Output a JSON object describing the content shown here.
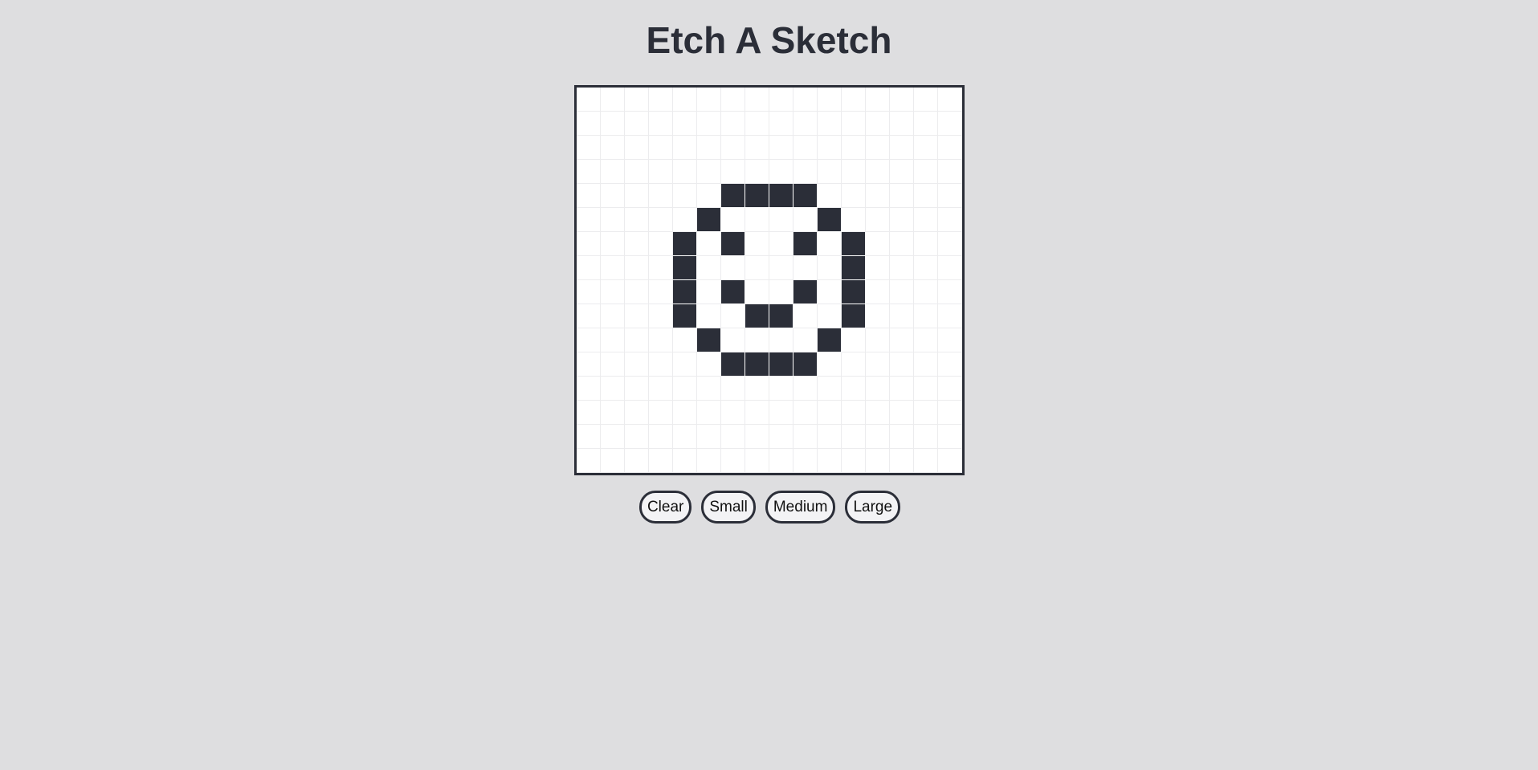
{
  "title": "Etch A Sketch",
  "grid": {
    "size": 16,
    "filled_cells": [
      [
        4,
        6
      ],
      [
        4,
        7
      ],
      [
        4,
        8
      ],
      [
        4,
        9
      ],
      [
        5,
        5
      ],
      [
        5,
        10
      ],
      [
        6,
        4
      ],
      [
        6,
        6
      ],
      [
        6,
        9
      ],
      [
        6,
        11
      ],
      [
        7,
        4
      ],
      [
        7,
        11
      ],
      [
        8,
        4
      ],
      [
        8,
        6
      ],
      [
        8,
        9
      ],
      [
        8,
        11
      ],
      [
        9,
        4
      ],
      [
        9,
        7
      ],
      [
        9,
        8
      ],
      [
        9,
        11
      ],
      [
        10,
        5
      ],
      [
        10,
        10
      ],
      [
        11,
        6
      ],
      [
        11,
        7
      ],
      [
        11,
        8
      ],
      [
        11,
        9
      ]
    ],
    "ink_color": "#2b2e38",
    "paper_color": "#ffffff"
  },
  "controls": {
    "clear_label": "Clear",
    "small_label": "Small",
    "medium_label": "Medium",
    "large_label": "Large"
  }
}
